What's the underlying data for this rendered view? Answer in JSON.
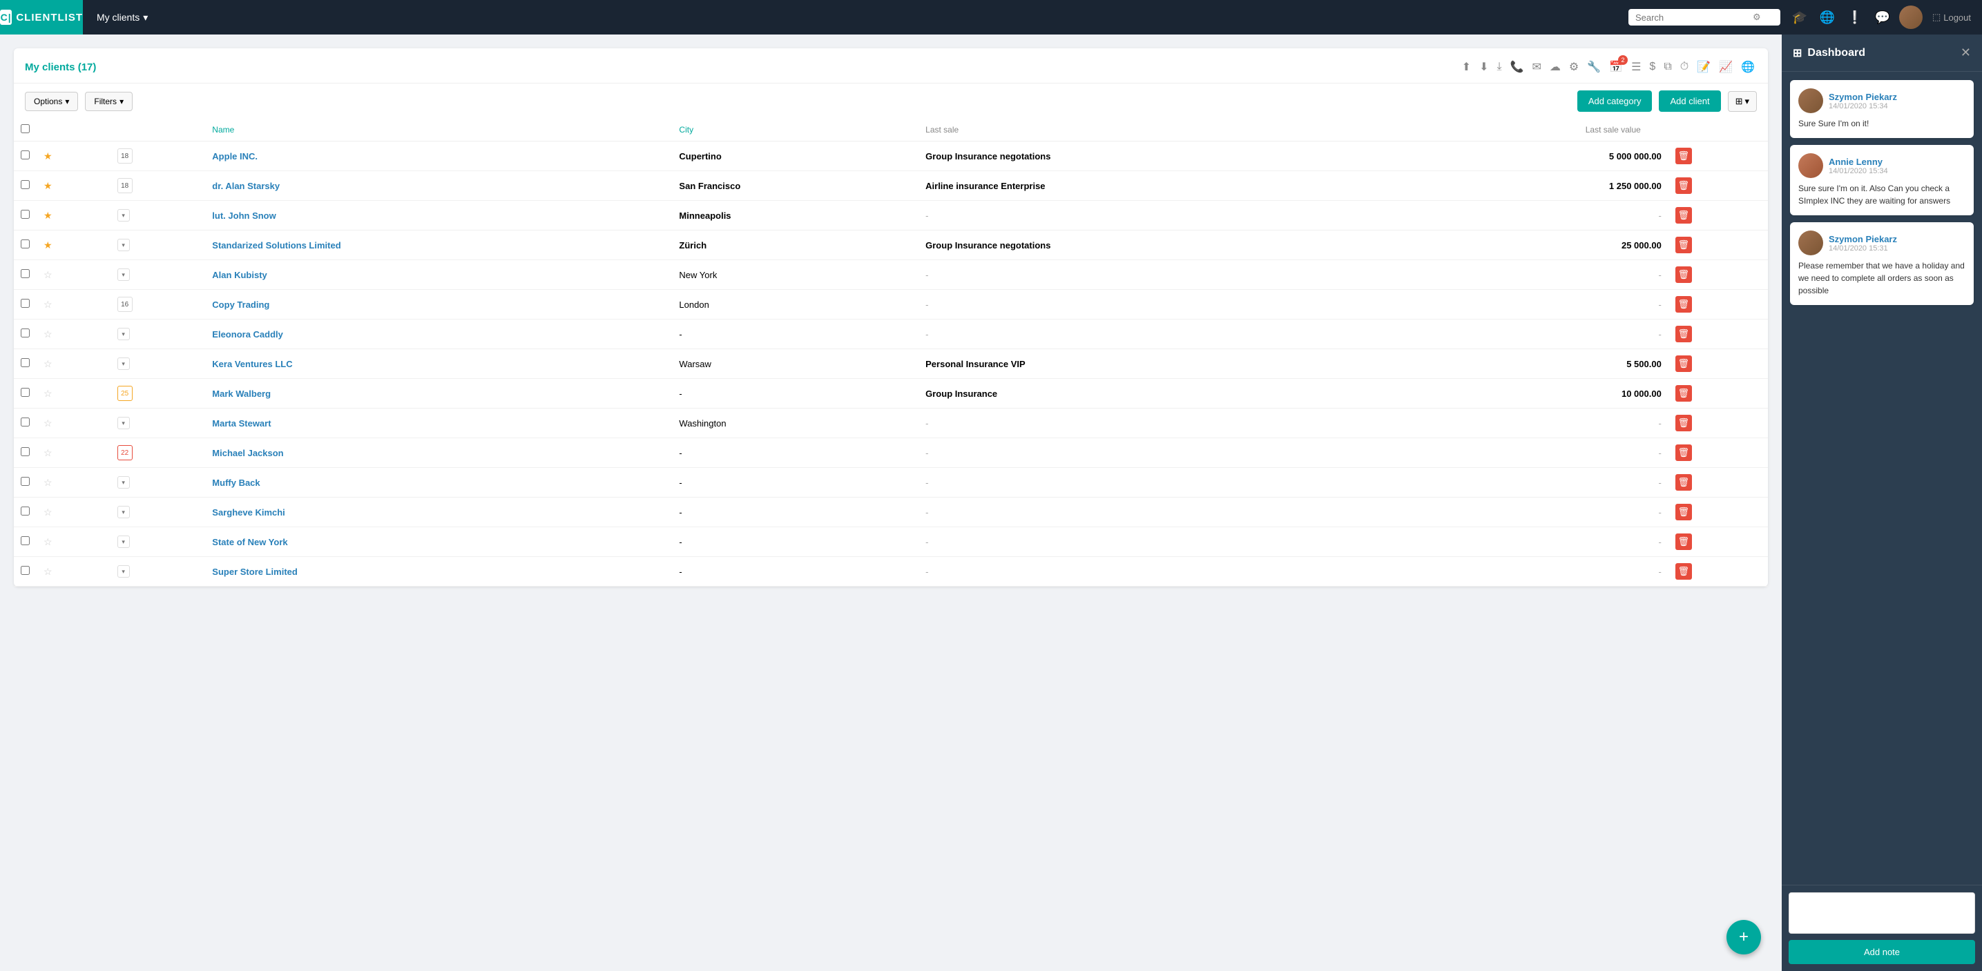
{
  "brand": {
    "icon": "C|",
    "name": "CLIENTLIST"
  },
  "topnav": {
    "my_clients_label": "My clients",
    "search_placeholder": "Search",
    "logout_label": "Logout"
  },
  "panel": {
    "title": "My clients",
    "count": "(17)"
  },
  "controls": {
    "options_label": "Options",
    "filters_label": "Filters",
    "add_category_label": "Add category",
    "add_client_label": "Add client"
  },
  "table": {
    "headers": {
      "name": "Name",
      "city": "City",
      "last_sale": "Last sale",
      "last_sale_value": "Last sale value"
    },
    "clients": [
      {
        "starred": true,
        "cal": "18",
        "cal_type": "normal",
        "name": "Apple INC.",
        "city": "Cupertino",
        "city_bold": true,
        "last_sale": "Group Insurance negotations",
        "last_sale_value": "5 000 000.00",
        "has_value": true
      },
      {
        "starred": true,
        "cal": "18",
        "cal_type": "normal",
        "name": "dr. Alan Starsky",
        "city": "San Francisco",
        "city_bold": true,
        "last_sale": "Airline insurance Enterprise",
        "last_sale_value": "1 250 000.00",
        "has_value": true
      },
      {
        "starred": true,
        "cal": null,
        "cal_type": "dropdown",
        "name": "lut. John Snow",
        "city": "Minneapolis",
        "city_bold": true,
        "last_sale": "-",
        "last_sale_value": "-",
        "has_value": false
      },
      {
        "starred": true,
        "cal": null,
        "cal_type": "dropdown",
        "name": "Standarized Solutions Limited",
        "city": "Zürich",
        "city_bold": true,
        "last_sale": "Group Insurance negotations",
        "last_sale_value": "25 000.00",
        "has_value": true
      },
      {
        "starred": false,
        "cal": null,
        "cal_type": "dropdown",
        "name": "Alan Kubisty",
        "city": "New York",
        "city_bold": false,
        "last_sale": "-",
        "last_sale_value": "-",
        "has_value": false
      },
      {
        "starred": false,
        "cal": "16",
        "cal_type": "normal",
        "name": "Copy Trading",
        "city": "London",
        "city_bold": false,
        "last_sale": "-",
        "last_sale_value": "-",
        "has_value": false
      },
      {
        "starred": false,
        "cal": null,
        "cal_type": "dropdown",
        "name": "Eleonora Caddly",
        "city": "-",
        "city_bold": false,
        "last_sale": "-",
        "last_sale_value": "-",
        "has_value": false
      },
      {
        "starred": false,
        "cal": null,
        "cal_type": "dropdown",
        "name": "Kera Ventures LLC",
        "city": "Warsaw",
        "city_bold": false,
        "last_sale": "Personal Insurance VIP",
        "last_sale_value": "5 500.00",
        "has_value": true
      },
      {
        "starred": false,
        "cal": "25",
        "cal_type": "orange",
        "name": "Mark Walberg",
        "city": "-",
        "city_bold": false,
        "last_sale": "Group Insurance",
        "last_sale_value": "10 000.00",
        "has_value": true
      },
      {
        "starred": false,
        "cal": null,
        "cal_type": "dropdown",
        "name": "Marta Stewart",
        "city": "Washington",
        "city_bold": false,
        "last_sale": "-",
        "last_sale_value": "-",
        "has_value": false
      },
      {
        "starred": false,
        "cal": "22",
        "cal_type": "red",
        "name": "Michael Jackson",
        "city": "-",
        "city_bold": false,
        "last_sale": "-",
        "last_sale_value": "-",
        "has_value": false
      },
      {
        "starred": false,
        "cal": null,
        "cal_type": "dropdown",
        "name": "Muffy Back",
        "city": "-",
        "city_bold": false,
        "last_sale": "-",
        "last_sale_value": "-",
        "has_value": false
      },
      {
        "starred": false,
        "cal": null,
        "cal_type": "dropdown",
        "name": "Sargheve Kimchi",
        "city": "-",
        "city_bold": false,
        "last_sale": "-",
        "last_sale_value": "-",
        "has_value": false
      },
      {
        "starred": false,
        "cal": null,
        "cal_type": "dropdown",
        "name": "State of New York",
        "city": "-",
        "city_bold": false,
        "last_sale": "-",
        "last_sale_value": "-",
        "has_value": false
      },
      {
        "starred": false,
        "cal": null,
        "cal_type": "dropdown",
        "name": "Super Store Limited",
        "city": "-",
        "city_bold": false,
        "last_sale": "-",
        "last_sale_value": "-",
        "has_value": false
      }
    ]
  },
  "dashboard": {
    "title": "Dashboard",
    "messages": [
      {
        "name": "Szymon Piekarz",
        "time": "14/01/2020 15:34",
        "text": "Sure Sure I'm on it!",
        "avatar_type": "szymon"
      },
      {
        "name": "Annie Lenny",
        "time": "14/01/2020 15:34",
        "text": "Sure sure I'm on it. Also Can you check a SImplex INC they are waiting for answers",
        "avatar_type": "annie"
      },
      {
        "name": "Szymon Piekarz",
        "time": "14/01/2020 15:31",
        "text": "Please remember that we have a holiday and we need to complete all orders as soon as possible",
        "avatar_type": "szymon"
      }
    ],
    "add_note_label": "Add note",
    "note_placeholder": ""
  },
  "toolbar_icons": {
    "badge_count": "2"
  }
}
